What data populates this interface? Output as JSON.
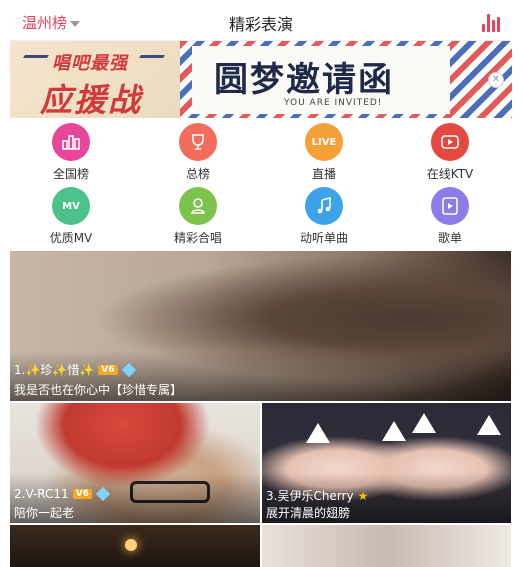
{
  "header": {
    "city": "温州榜",
    "title": "精彩表演",
    "chart_icon": "bar-chart-icon"
  },
  "banner": {
    "left_line1": "唱吧最强",
    "left_line2": "应援战",
    "main_text": "圆梦邀请函",
    "sub_text": "YOU ARE INVITED!",
    "close_icon": "close-icon"
  },
  "categories": [
    {
      "label": "全国榜",
      "icon": "podium-icon",
      "color": "#e8469a"
    },
    {
      "label": "总榜",
      "icon": "trophy-icon",
      "color": "#f36b5b"
    },
    {
      "label": "直播",
      "icon": "live-icon",
      "icon_text": "LIVE",
      "color": "#f5a13a"
    },
    {
      "label": "在线KTV",
      "icon": "play-video-icon",
      "color": "#e4493f"
    },
    {
      "label": "优质MV",
      "icon": "mv-icon",
      "icon_text": "MV",
      "color": "#4cc28a"
    },
    {
      "label": "精彩合唱",
      "icon": "duet-icon",
      "color": "#7dc24a"
    },
    {
      "label": "动听单曲",
      "icon": "music-note-icon",
      "color": "#3ea2e8"
    },
    {
      "label": "歌单",
      "icon": "playlist-icon",
      "color": "#8d7be8"
    }
  ],
  "videos": [
    {
      "rank": "1.✨珍✨惜✨",
      "badge": "V6",
      "desc": "我是否也在你心中【珍惜专属】"
    },
    {
      "rank": "2.V-RC11",
      "badge": "V6",
      "desc": "陪你一起老"
    },
    {
      "rank": "3.吴伊乐Cherry",
      "badge": "★",
      "desc": "展开清晨的翅膀"
    }
  ]
}
